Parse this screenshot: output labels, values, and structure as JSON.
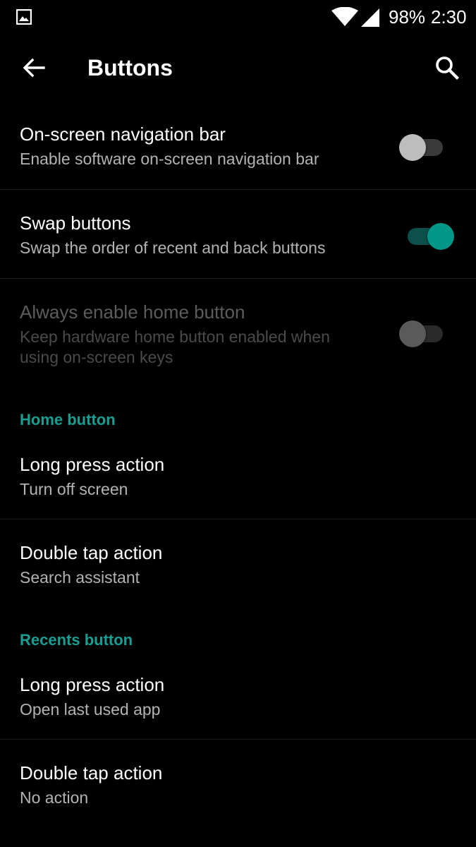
{
  "status_bar": {
    "battery": "98%",
    "time": "2:30",
    "icons": [
      "image-icon",
      "wifi-icon",
      "cell-signal-icon"
    ]
  },
  "toolbar": {
    "title": "Buttons",
    "icons": [
      "back-arrow-icon",
      "search-icon"
    ]
  },
  "colors": {
    "background": "#000000",
    "accent": "#009688",
    "section_header": "#199e93",
    "secondary_text": "#b3b3b3"
  },
  "settings": {
    "nav_bar": {
      "title": "On-screen navigation bar",
      "summary": "Enable software on-screen navigation bar",
      "enabled": false
    },
    "swap_buttons": {
      "title": "Swap buttons",
      "summary": "Swap the order of recent and back buttons",
      "enabled": true
    },
    "always_home": {
      "title": "Always enable home button",
      "summary_line1": "Keep hardware home button enabled when",
      "summary_line2": "using on-screen keys",
      "enabled": false,
      "disabled": true
    }
  },
  "home_section": {
    "header": "Home button",
    "long_press": {
      "title": "Long press action",
      "summary": "Turn off screen"
    },
    "double_tap": {
      "title": "Double tap action",
      "summary": "Search assistant"
    }
  },
  "recents_section": {
    "header": "Recents button",
    "long_press": {
      "title": "Long press action",
      "summary": "Open last used app"
    },
    "double_tap": {
      "title": "Double tap action",
      "summary": "No action"
    }
  }
}
